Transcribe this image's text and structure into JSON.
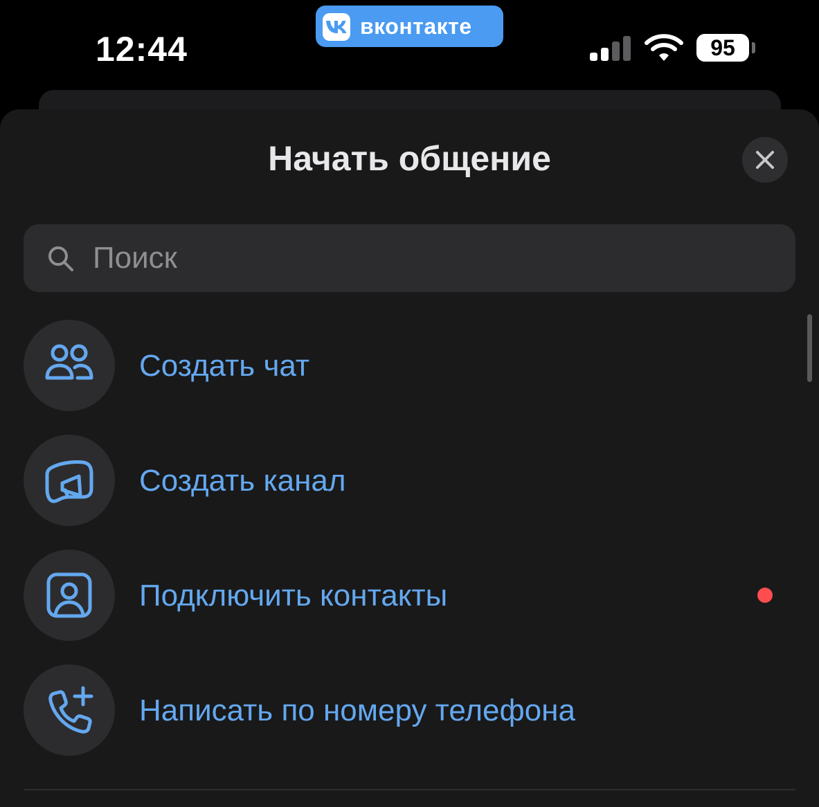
{
  "status_bar": {
    "time": "12:44",
    "app_pill": "вконтакте",
    "vk_logo": "VK",
    "battery": "95",
    "signal_icon": "cellular-signal-icon",
    "wifi_icon": "wifi-icon"
  },
  "sheet": {
    "title": "Начать общение",
    "close_icon": "close-icon"
  },
  "search": {
    "placeholder": "Поиск",
    "value": "",
    "icon": "search-icon"
  },
  "menu": {
    "items": [
      {
        "label": "Создать чат",
        "icon": "people-icon"
      },
      {
        "label": "Создать канал",
        "icon": "channel-megaphone-icon"
      },
      {
        "label": "Подключить контакты",
        "icon": "contact-card-icon",
        "badge": "red-dot"
      },
      {
        "label": "Написать по номеру телефона",
        "icon": "phone-add-icon"
      }
    ]
  },
  "colors": {
    "accent": "#64a8ef",
    "pill": "#4a9bf1",
    "background": "#19191a",
    "icon_bg": "#2c2c2e",
    "notification_dot": "#ff4d4f"
  }
}
